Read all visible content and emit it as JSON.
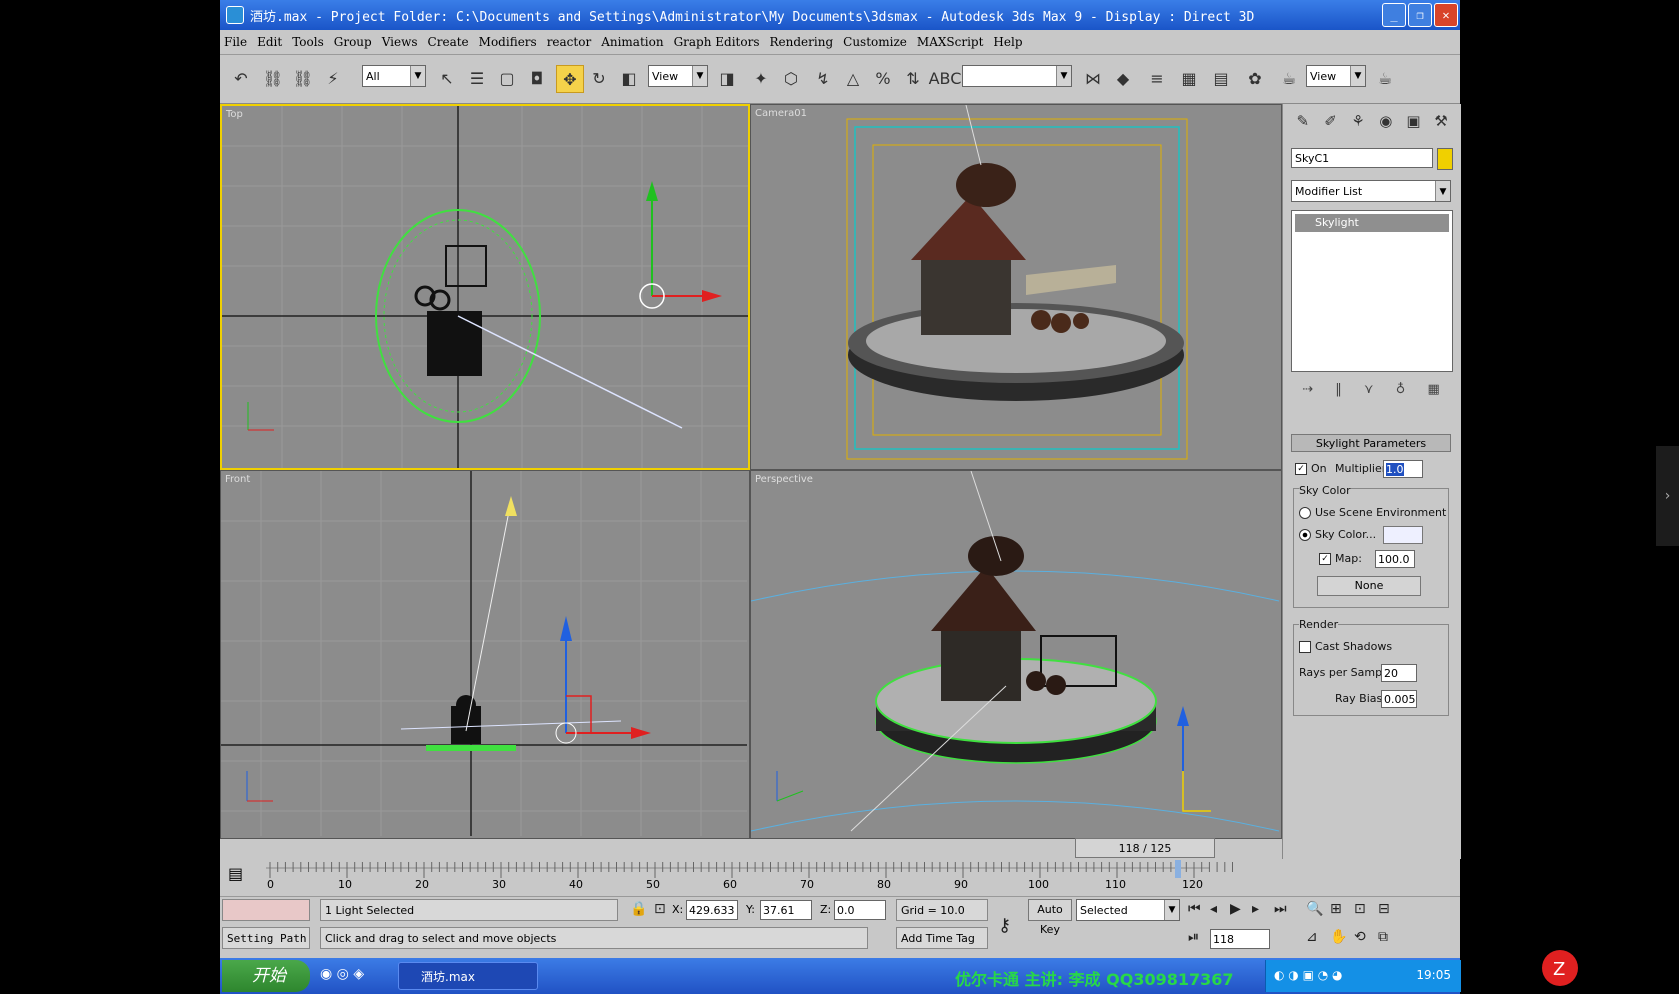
{
  "window": {
    "title": "酒坊.max   - Project Folder: C:\\Documents and Settings\\Administrator\\My Documents\\3dsmax   - Autodesk 3ds Max 9   - Display : Direct 3D",
    "buttons": {
      "minimize": "_",
      "restore": "❐",
      "close": "✕"
    }
  },
  "menu": [
    "File",
    "Edit",
    "Tools",
    "Group",
    "Views",
    "Create",
    "Modifiers",
    "reactor",
    "Animation",
    "Graph Editors",
    "Rendering",
    "Customize",
    "MAXScript",
    "Help"
  ],
  "toolbar": {
    "selection_filter": "All",
    "ref_coord": "View",
    "named_selection": "",
    "ref_coord2": "View"
  },
  "viewports": {
    "top": "Top",
    "camera": "Camera01",
    "front": "Front",
    "perspective": "Perspective"
  },
  "command_panel": {
    "object_name": "SkyC1",
    "modifier_list": "Modifier List",
    "stack_item": "Skylight",
    "rollout_title": "Skylight Parameters",
    "on_label": "On",
    "multiplier_label": "Multiplier:",
    "multiplier_value": "1.0",
    "sky_color_group": "Sky Color",
    "use_scene_env": "Use Scene Environment",
    "sky_color_label": "Sky Color...",
    "map_label": "Map:",
    "map_value": "100.0",
    "map_button": "None",
    "render_group": "Render",
    "cast_shadows": "Cast Shadows",
    "rays_label": "Rays per Sample:",
    "rays_value": "20",
    "ray_bias_label": "Ray Bias:",
    "ray_bias_value": "0.005"
  },
  "timeline": {
    "slider": "118 / 125",
    "ticks": [
      "0",
      "10",
      "20",
      "30",
      "40",
      "50",
      "60",
      "70",
      "80",
      "90",
      "100",
      "110",
      "120"
    ]
  },
  "status": {
    "selection": "1 Light Selected",
    "prompt": "Click and drag to select and move objects",
    "x_label": "X:",
    "x_value": "429.633",
    "y_label": "Y:",
    "y_value": "37.61",
    "z_label": "Z:",
    "z_value": "0.0",
    "grid": "Grid = 10.0",
    "add_time_tag": "Add Time Tag",
    "setting_path": "Setting Path",
    "auto_key": "Auto Key",
    "key_filter": "Selected",
    "frame": "118"
  },
  "taskbar": {
    "start": "开始",
    "task_item": "酒坊.max",
    "marquee": "优尔卡通  主讲: 李成 QQ309817367",
    "clock": "19:05"
  },
  "colors": {
    "active_viewport": "#f0d000",
    "title_bar": "#2a66d8",
    "viewport_bg": "#8c8c8c"
  }
}
